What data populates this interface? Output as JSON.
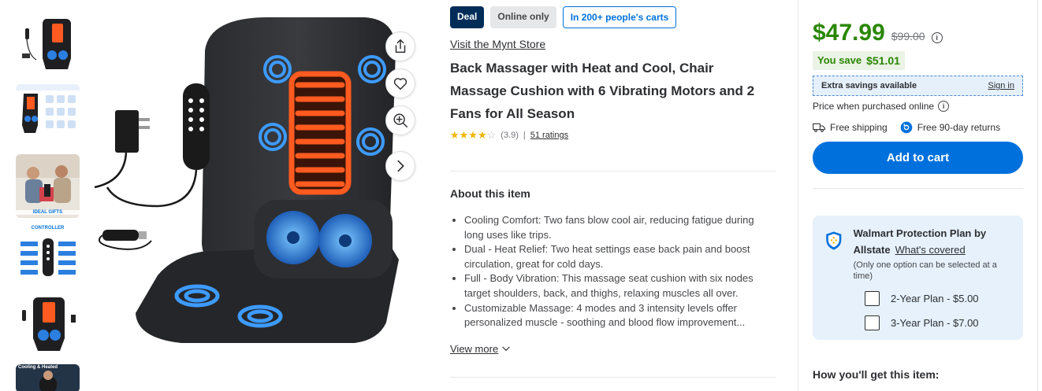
{
  "thumbnails": {
    "captions": [
      "",
      "",
      "IDEAL GIFTS",
      "CONTROLLER",
      "",
      "Cooling & Heated"
    ]
  },
  "image_actions": [
    "share-icon",
    "heart-icon",
    "zoom-in-icon",
    "chevron-right-icon"
  ],
  "badges": {
    "deal": "Deal",
    "online": "Online only",
    "carts": "In 200+ people's carts"
  },
  "store_link": "Visit the Mynt Store",
  "title": "Back Massager with Heat and Cool, Chair Massage Cushion with 6 Vibrating Motors and 2 Fans for All Season",
  "rating": {
    "value": "(3.9)",
    "separator": "|",
    "count_label": "51 ratings",
    "stars_full": 3,
    "stars_half": 1
  },
  "about": {
    "heading": "About this item",
    "bullets": [
      "Cooling Comfort: Two fans blow cool air, reducing fatigue during long uses like trips.",
      "Dual - Heat Relief: Two heat settings ease back pain and boost circulation, great for cold days.",
      "Full - Body Vibration: This massage seat cushion with six nodes target shoulders, back, and thighs, relaxing muscles all over.",
      "Customizable Massage: 4 modes and 3 intensity levels offer personalized muscle - soothing and blood flow improvement..."
    ],
    "view_more": "View more"
  },
  "buybox": {
    "price": "$47.99",
    "was_price": "$99.00",
    "info": "i",
    "savings_label": "You save",
    "savings_value": "$51.01",
    "extra_savings": "Extra savings available",
    "sign_in": "Sign in",
    "price_note": "Price when purchased online",
    "shipping": "Free shipping",
    "returns": "Free 90-day returns",
    "add_to_cart": "Add to cart",
    "protection_title": "Walmart Protection Plan by Allstate",
    "protection_link": "What's covered",
    "protection_note": "(Only one option can be selected at a time)",
    "plans": [
      "2-Year Plan - $5.00",
      "3-Year Plan - $7.00"
    ],
    "how_heading": "How you'll get this item:"
  },
  "colors": {
    "walmart_blue": "#0071dc",
    "price_green": "#2a8703",
    "deal_navy": "#002d58",
    "star_gold": "#f1b505"
  }
}
